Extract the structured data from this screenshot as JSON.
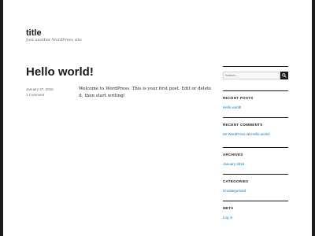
{
  "site": {
    "title": "title",
    "description": "Just another WordPress site"
  },
  "post": {
    "title": "Hello world!",
    "date": "January 27, 2016",
    "comments": "1 Comment",
    "content": "Welcome to WordPress. This is your first post. Edit or delete it, then start writing!"
  },
  "sidebar": {
    "search_placeholder": "Search …",
    "recent_posts": {
      "title": "RECENT POSTS",
      "items": [
        "Hello world!"
      ]
    },
    "recent_comments": {
      "title": "RECENT COMMENTS",
      "author": "Mr WordPress",
      "on": "on",
      "post": "Hello world!"
    },
    "archives": {
      "title": "ARCHIVES",
      "items": [
        "January 2016"
      ]
    },
    "categories": {
      "title": "CATEGORIES",
      "items": [
        "Uncategorized"
      ]
    },
    "meta": {
      "title": "META",
      "items": [
        "Log in"
      ]
    }
  },
  "colors": {
    "link": "#007acc",
    "text": "#1a1a1a",
    "border": "#1a1a1a"
  }
}
